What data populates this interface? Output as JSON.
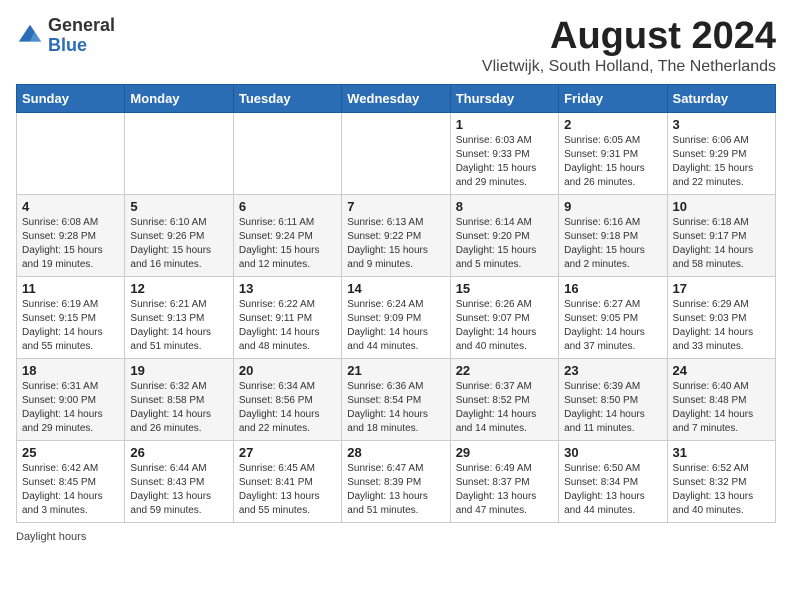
{
  "logo": {
    "general": "General",
    "blue": "Blue"
  },
  "title": {
    "month_year": "August 2024",
    "location": "Vlietwijk, South Holland, The Netherlands"
  },
  "header_days": [
    "Sunday",
    "Monday",
    "Tuesday",
    "Wednesday",
    "Thursday",
    "Friday",
    "Saturday"
  ],
  "weeks": [
    {
      "days": [
        {
          "num": "",
          "info": ""
        },
        {
          "num": "",
          "info": ""
        },
        {
          "num": "",
          "info": ""
        },
        {
          "num": "",
          "info": ""
        },
        {
          "num": "1",
          "info": "Sunrise: 6:03 AM\nSunset: 9:33 PM\nDaylight: 15 hours and 29 minutes."
        },
        {
          "num": "2",
          "info": "Sunrise: 6:05 AM\nSunset: 9:31 PM\nDaylight: 15 hours and 26 minutes."
        },
        {
          "num": "3",
          "info": "Sunrise: 6:06 AM\nSunset: 9:29 PM\nDaylight: 15 hours and 22 minutes."
        }
      ]
    },
    {
      "days": [
        {
          "num": "4",
          "info": "Sunrise: 6:08 AM\nSunset: 9:28 PM\nDaylight: 15 hours and 19 minutes."
        },
        {
          "num": "5",
          "info": "Sunrise: 6:10 AM\nSunset: 9:26 PM\nDaylight: 15 hours and 16 minutes."
        },
        {
          "num": "6",
          "info": "Sunrise: 6:11 AM\nSunset: 9:24 PM\nDaylight: 15 hours and 12 minutes."
        },
        {
          "num": "7",
          "info": "Sunrise: 6:13 AM\nSunset: 9:22 PM\nDaylight: 15 hours and 9 minutes."
        },
        {
          "num": "8",
          "info": "Sunrise: 6:14 AM\nSunset: 9:20 PM\nDaylight: 15 hours and 5 minutes."
        },
        {
          "num": "9",
          "info": "Sunrise: 6:16 AM\nSunset: 9:18 PM\nDaylight: 15 hours and 2 minutes."
        },
        {
          "num": "10",
          "info": "Sunrise: 6:18 AM\nSunset: 9:17 PM\nDaylight: 14 hours and 58 minutes."
        }
      ]
    },
    {
      "days": [
        {
          "num": "11",
          "info": "Sunrise: 6:19 AM\nSunset: 9:15 PM\nDaylight: 14 hours and 55 minutes."
        },
        {
          "num": "12",
          "info": "Sunrise: 6:21 AM\nSunset: 9:13 PM\nDaylight: 14 hours and 51 minutes."
        },
        {
          "num": "13",
          "info": "Sunrise: 6:22 AM\nSunset: 9:11 PM\nDaylight: 14 hours and 48 minutes."
        },
        {
          "num": "14",
          "info": "Sunrise: 6:24 AM\nSunset: 9:09 PM\nDaylight: 14 hours and 44 minutes."
        },
        {
          "num": "15",
          "info": "Sunrise: 6:26 AM\nSunset: 9:07 PM\nDaylight: 14 hours and 40 minutes."
        },
        {
          "num": "16",
          "info": "Sunrise: 6:27 AM\nSunset: 9:05 PM\nDaylight: 14 hours and 37 minutes."
        },
        {
          "num": "17",
          "info": "Sunrise: 6:29 AM\nSunset: 9:03 PM\nDaylight: 14 hours and 33 minutes."
        }
      ]
    },
    {
      "days": [
        {
          "num": "18",
          "info": "Sunrise: 6:31 AM\nSunset: 9:00 PM\nDaylight: 14 hours and 29 minutes."
        },
        {
          "num": "19",
          "info": "Sunrise: 6:32 AM\nSunset: 8:58 PM\nDaylight: 14 hours and 26 minutes."
        },
        {
          "num": "20",
          "info": "Sunrise: 6:34 AM\nSunset: 8:56 PM\nDaylight: 14 hours and 22 minutes."
        },
        {
          "num": "21",
          "info": "Sunrise: 6:36 AM\nSunset: 8:54 PM\nDaylight: 14 hours and 18 minutes."
        },
        {
          "num": "22",
          "info": "Sunrise: 6:37 AM\nSunset: 8:52 PM\nDaylight: 14 hours and 14 minutes."
        },
        {
          "num": "23",
          "info": "Sunrise: 6:39 AM\nSunset: 8:50 PM\nDaylight: 14 hours and 11 minutes."
        },
        {
          "num": "24",
          "info": "Sunrise: 6:40 AM\nSunset: 8:48 PM\nDaylight: 14 hours and 7 minutes."
        }
      ]
    },
    {
      "days": [
        {
          "num": "25",
          "info": "Sunrise: 6:42 AM\nSunset: 8:45 PM\nDaylight: 14 hours and 3 minutes."
        },
        {
          "num": "26",
          "info": "Sunrise: 6:44 AM\nSunset: 8:43 PM\nDaylight: 13 hours and 59 minutes."
        },
        {
          "num": "27",
          "info": "Sunrise: 6:45 AM\nSunset: 8:41 PM\nDaylight: 13 hours and 55 minutes."
        },
        {
          "num": "28",
          "info": "Sunrise: 6:47 AM\nSunset: 8:39 PM\nDaylight: 13 hours and 51 minutes."
        },
        {
          "num": "29",
          "info": "Sunrise: 6:49 AM\nSunset: 8:37 PM\nDaylight: 13 hours and 47 minutes."
        },
        {
          "num": "30",
          "info": "Sunrise: 6:50 AM\nSunset: 8:34 PM\nDaylight: 13 hours and 44 minutes."
        },
        {
          "num": "31",
          "info": "Sunrise: 6:52 AM\nSunset: 8:32 PM\nDaylight: 13 hours and 40 minutes."
        }
      ]
    }
  ],
  "footer": {
    "text": "Daylight hours"
  }
}
